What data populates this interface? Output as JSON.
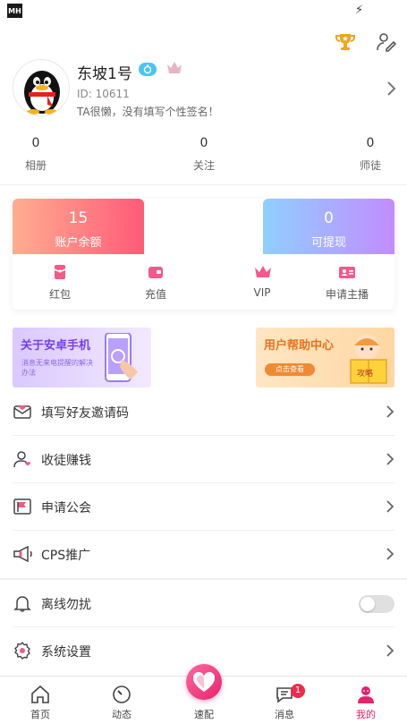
{
  "status_bar": {
    "app_icon_text": "MH"
  },
  "profile": {
    "name": "东坡1号",
    "id_text": "ID: 10611",
    "signature": "TA很懒，没有填写个性签名！"
  },
  "stats": [
    {
      "value": "0",
      "label": "相册"
    },
    {
      "value": "0",
      "label": "关注"
    },
    {
      "value": "0",
      "label": "师徒"
    }
  ],
  "wallet": {
    "balance": {
      "value": "15",
      "label": "账户余额"
    },
    "withdrawable": {
      "value": "0",
      "label": "可提现"
    },
    "actions": [
      {
        "label": "红包",
        "icon": "red-packet-icon"
      },
      {
        "label": "充值",
        "icon": "wallet-icon"
      },
      {
        "label": "VIP",
        "icon": "crown-icon"
      },
      {
        "label": "申请主播",
        "icon": "id-card-icon"
      }
    ]
  },
  "banners": {
    "left": {
      "title": "关于安卓手机",
      "subtitle": "消息无来电提醒的解决办法"
    },
    "right": {
      "title": "用户帮助中心",
      "button": "点击查看",
      "book_text": "攻略"
    }
  },
  "menu": [
    {
      "label": "填写好友邀请码",
      "icon": "envelope-heart-icon"
    },
    {
      "label": "收徒赚钱",
      "icon": "user-heart-icon"
    },
    {
      "label": "申请公会",
      "icon": "flag-icon"
    },
    {
      "label": "CPS推广",
      "icon": "megaphone-icon"
    },
    {
      "label": "离线勿扰",
      "icon": "bell-icon",
      "toggle": false
    },
    {
      "label": "系统设置",
      "icon": "gear-icon"
    }
  ],
  "tabbar": [
    {
      "label": "首页",
      "icon": "home-icon"
    },
    {
      "label": "动态",
      "icon": "compass-icon"
    },
    {
      "label": "速配",
      "icon": "heart-icon"
    },
    {
      "label": "消息",
      "icon": "message-icon",
      "badge": "1"
    },
    {
      "label": "我的",
      "icon": "profile-icon",
      "active": true
    }
  ],
  "colors": {
    "accent": "#e8216d",
    "balance_gradient_start": "#ffad90",
    "withdraw_gradient_end": "#c28cff"
  }
}
